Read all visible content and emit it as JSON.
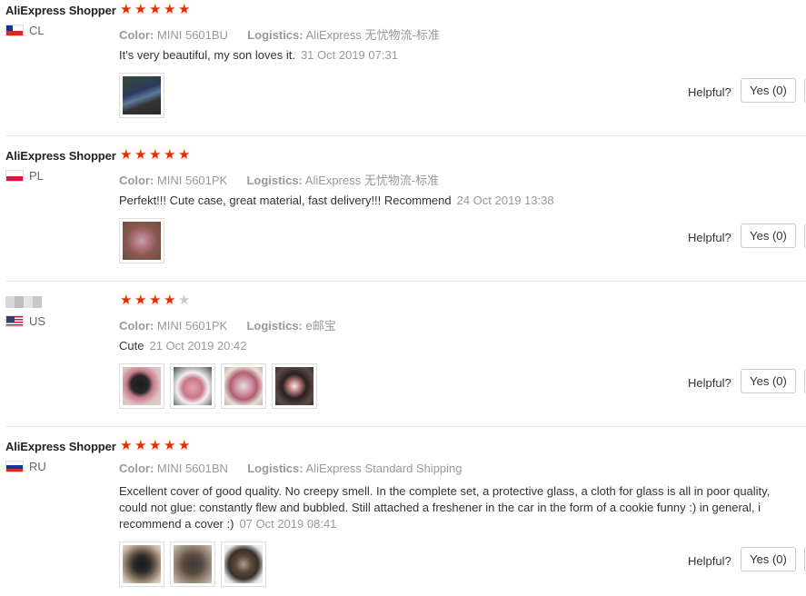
{
  "labels": {
    "color": "Color:",
    "logistics": "Logistics:",
    "helpful": "Helpful?"
  },
  "reviews": [
    {
      "user": "AliExpress Shopper",
      "country": "CL",
      "rating": 5,
      "color": "MINI 5601BU",
      "logistics": "AliExpress 无忧物流-标准",
      "text": "It's very beautiful, my son loves it.",
      "date": "31 Oct 2019 07:31",
      "photos": 1,
      "helpful_yes": "Yes (0)"
    },
    {
      "user": "AliExpress Shopper",
      "country": "PL",
      "rating": 5,
      "color": "MINI 5601PK",
      "logistics": "AliExpress 无忧物流-标准",
      "text": "Perfekt!!! Cute case, great material, fast delivery!!! Recommend",
      "date": "24 Oct 2019 13:38",
      "photos": 1,
      "helpful_yes": "Yes (0)"
    },
    {
      "user": "",
      "country": "US",
      "rating": 4,
      "color": "MINI 5601PK",
      "logistics": "e邮宝",
      "text": "Cute",
      "date": "21 Oct 2019 20:42",
      "photos": 4,
      "helpful_yes": "Yes (0)"
    },
    {
      "user": "AliExpress Shopper",
      "country": "RU",
      "rating": 5,
      "color": "MINI 5601BN",
      "logistics": "AliExpress Standard Shipping",
      "text": "Excellent cover of good quality. No creepy smell. In the complete set, a protective glass, a cloth for glass is all in poor quality, could not glue: constantly flew and bubbled. Still attached a freshener in the car in the form of a cookie funny :) in general, i recommend a cover :)",
      "date": "07 Oct 2019 08:41",
      "photos": 3,
      "helpful_yes": "Yes (0)"
    }
  ],
  "colors": {
    "star_on": "#e62e04",
    "star_off": "#cccccc",
    "muted_text": "#999999"
  }
}
